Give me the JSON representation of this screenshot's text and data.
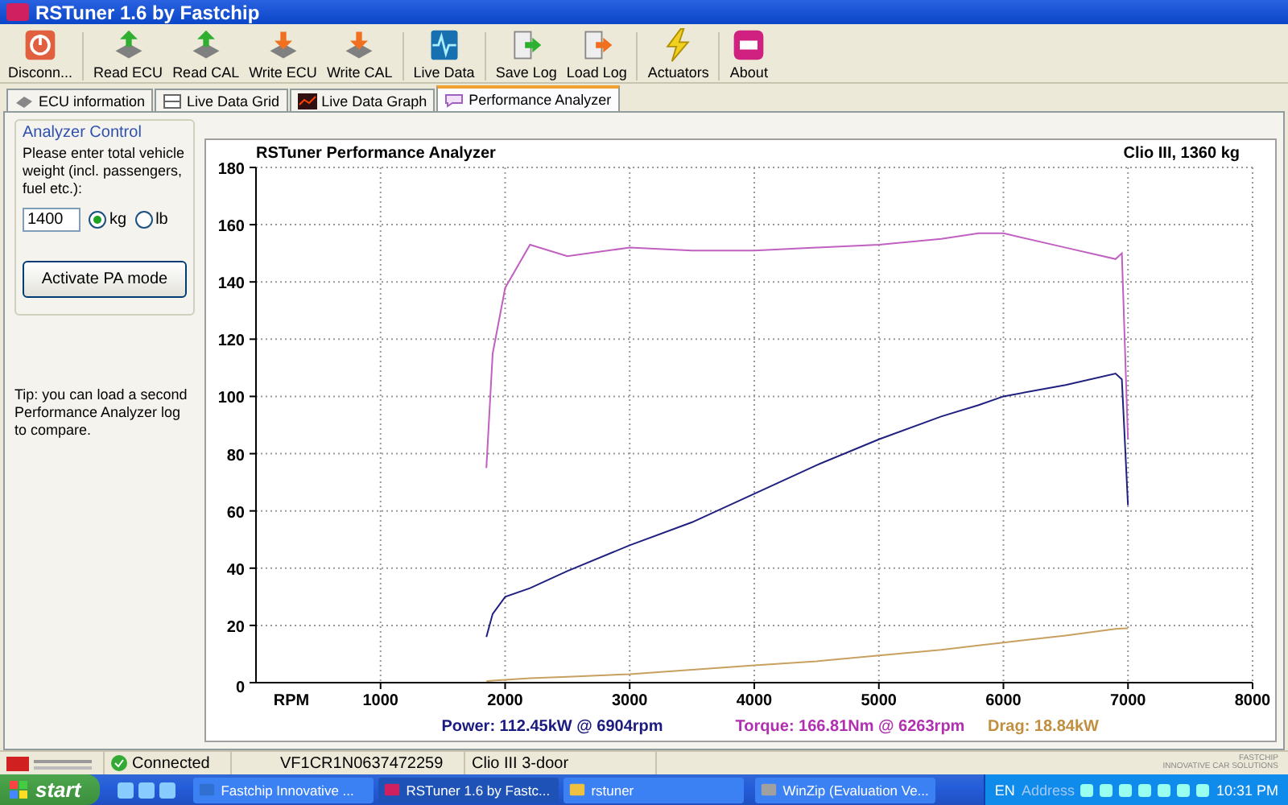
{
  "window": {
    "title": "RSTuner 1.6 by Fastchip"
  },
  "toolbar": [
    {
      "label": "Disconn...",
      "kind": "power"
    },
    {
      "label": "Read ECU",
      "kind": "read"
    },
    {
      "label": "Read CAL",
      "kind": "read"
    },
    {
      "label": "Write ECU",
      "kind": "write"
    },
    {
      "label": "Write CAL",
      "kind": "write"
    },
    {
      "label": "Live Data",
      "kind": "live"
    },
    {
      "label": "Save Log",
      "kind": "save"
    },
    {
      "label": "Load Log",
      "kind": "load"
    },
    {
      "label": "Actuators",
      "kind": "bolt"
    },
    {
      "label": "About",
      "kind": "about"
    }
  ],
  "tabs": [
    {
      "label": "ECU information",
      "kind": "chip",
      "selected": false
    },
    {
      "label": "Live Data Grid",
      "kind": "grid",
      "selected": false
    },
    {
      "label": "Live Data Graph",
      "kind": "graph",
      "selected": false
    },
    {
      "label": "Performance Analyzer",
      "kind": "analyzer",
      "selected": true
    }
  ],
  "analyzer_control": {
    "title": "Analyzer Control",
    "prompt": "Please enter total vehicle weight (incl. passengers, fuel etc.):",
    "weight": "1400",
    "units": [
      {
        "label": "kg",
        "selected": true
      },
      {
        "label": "lb",
        "selected": false
      }
    ],
    "button": "Activate PA mode"
  },
  "tip": "Tip: you can load a second Performance Analyzer log to compare.",
  "chart": {
    "subtitle": "Clio III, 1360 kg",
    "legend": [
      {
        "text": "Power: 112.45kW @ 6904rpm",
        "color": "#1a1a80"
      },
      {
        "text": "Torque: 166.81Nm @ 6263rpm",
        "color": "#b030b0"
      },
      {
        "text": "Drag: 18.84kW",
        "color": "#c09040"
      }
    ],
    "chart_data": {
      "type": "line",
      "title": "RSTuner Performance Analyzer",
      "xlabel": "RPM",
      "x": [
        1850,
        1900,
        2000,
        2200,
        2500,
        3000,
        3500,
        4000,
        4500,
        5000,
        5500,
        5800,
        6000,
        6500,
        6900,
        6950,
        7000
      ],
      "series": [
        {
          "color": "#c060c0",
          "values": [
            75,
            115,
            138,
            153,
            149,
            152,
            151,
            151,
            152,
            153,
            155,
            157,
            157,
            152,
            148,
            150,
            85
          ]
        },
        {
          "color": "#202080",
          "values": [
            16,
            24,
            30,
            33,
            39,
            48,
            56,
            66,
            76,
            85,
            93,
            97,
            100,
            104,
            108,
            106,
            62
          ]
        },
        {
          "color": "#c8a060",
          "values": [
            0.5,
            0.7,
            1,
            1.5,
            2,
            3,
            4.5,
            6,
            7.5,
            9.5,
            11.5,
            13,
            14,
            16.5,
            18.8,
            18.9,
            19
          ]
        }
      ],
      "xlim": [
        0,
        8000
      ],
      "grid": true,
      "ylim": [
        0,
        180
      ],
      "xticks": [
        1000,
        2000,
        3000,
        4000,
        5000,
        6000,
        7000,
        8000
      ],
      "yticks": [
        0,
        20,
        40,
        60,
        80,
        100,
        120,
        140,
        160,
        180
      ]
    }
  },
  "status_bar": {
    "connection": "Connected",
    "vin": "VF1CR1N0637472259",
    "vehicle": "Clio III 3-door",
    "brand": "FASTCHIP",
    "tagline": "INNOVATIVE CAR SOLUTIONS"
  },
  "taskbar": {
    "start": "start",
    "tasks": [
      {
        "label": "Fastchip Innovative ...",
        "kind": "ie",
        "selected": false
      },
      {
        "label": "RSTuner 1.6 by Fastc...",
        "kind": "rs",
        "selected": true
      },
      {
        "label": "rstuner",
        "kind": "folder",
        "selected": false
      },
      {
        "label": "WinZip (Evaluation Ve...",
        "kind": "zip",
        "selected": false
      }
    ],
    "language": "EN",
    "address": "Address",
    "clock": "10:31 PM"
  }
}
